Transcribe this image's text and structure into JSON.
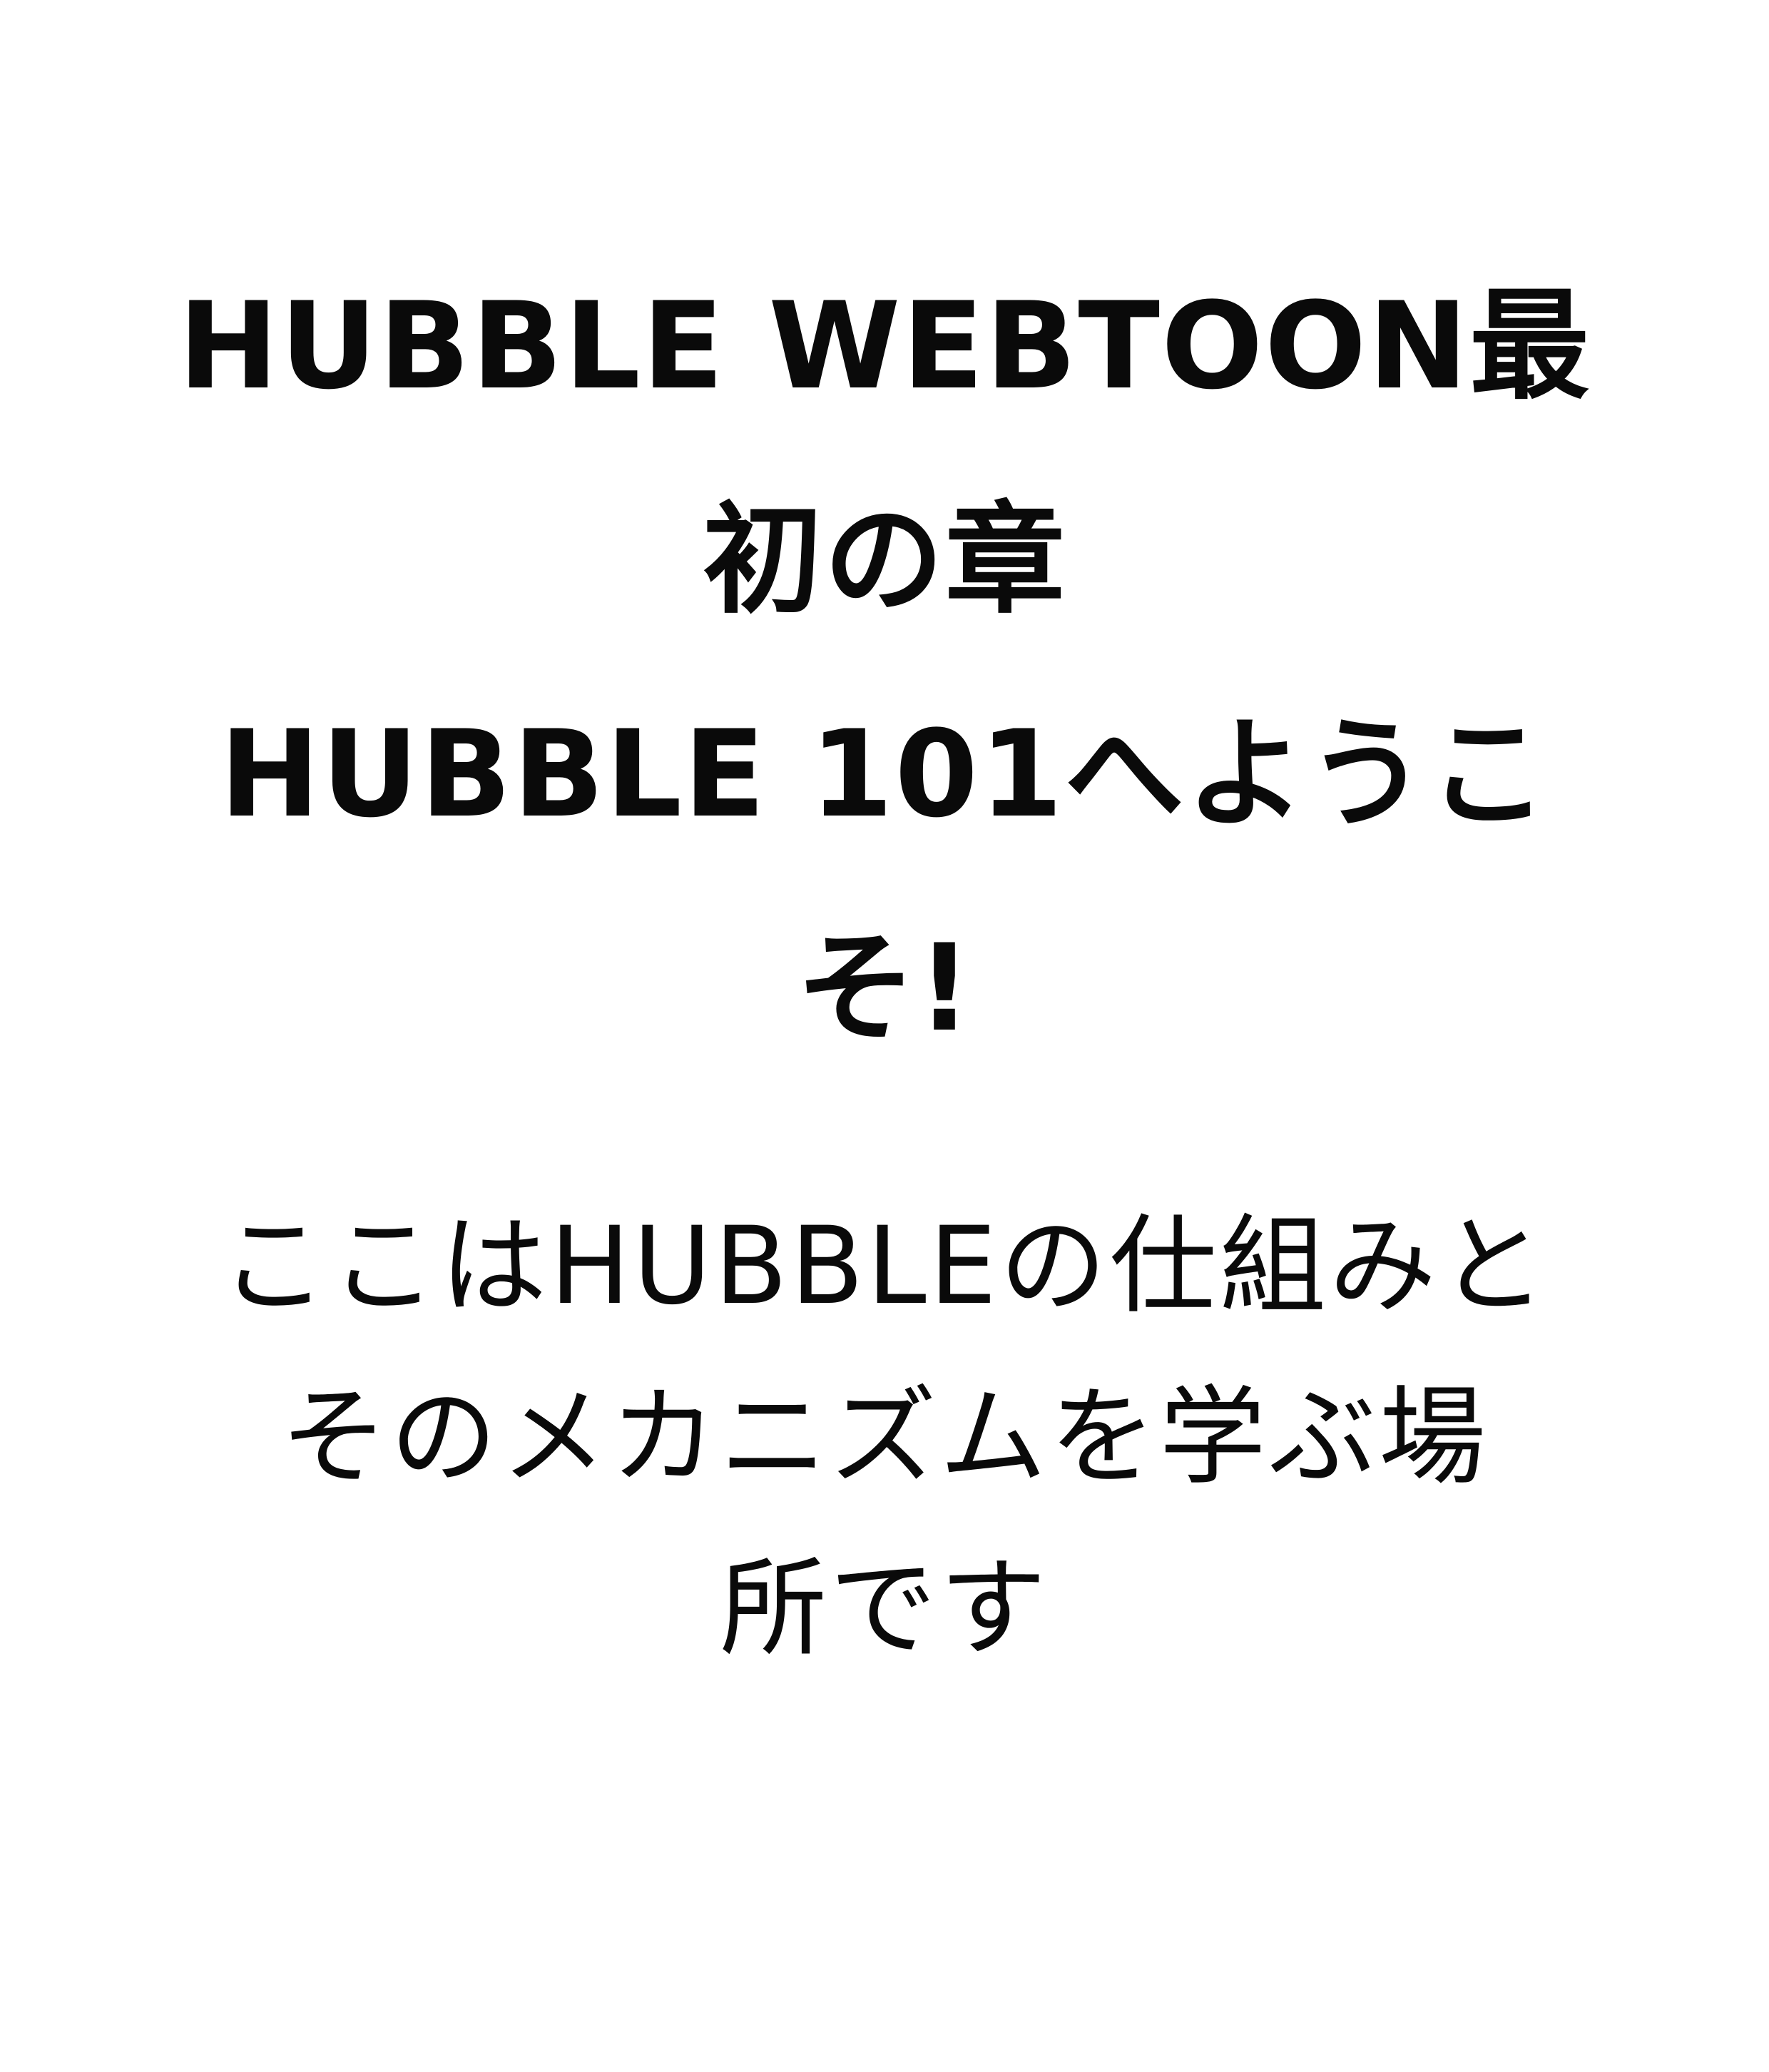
{
  "title": {
    "lines": [
      "HUBBLE WEBTOON最",
      "初の章",
      "HUBBLE 101へようこ",
      "そ!"
    ]
  },
  "body": {
    "lines": [
      "ここはHUBBLEの仕組みと",
      "そのメカニズムを学ぶ場",
      "所です"
    ]
  }
}
